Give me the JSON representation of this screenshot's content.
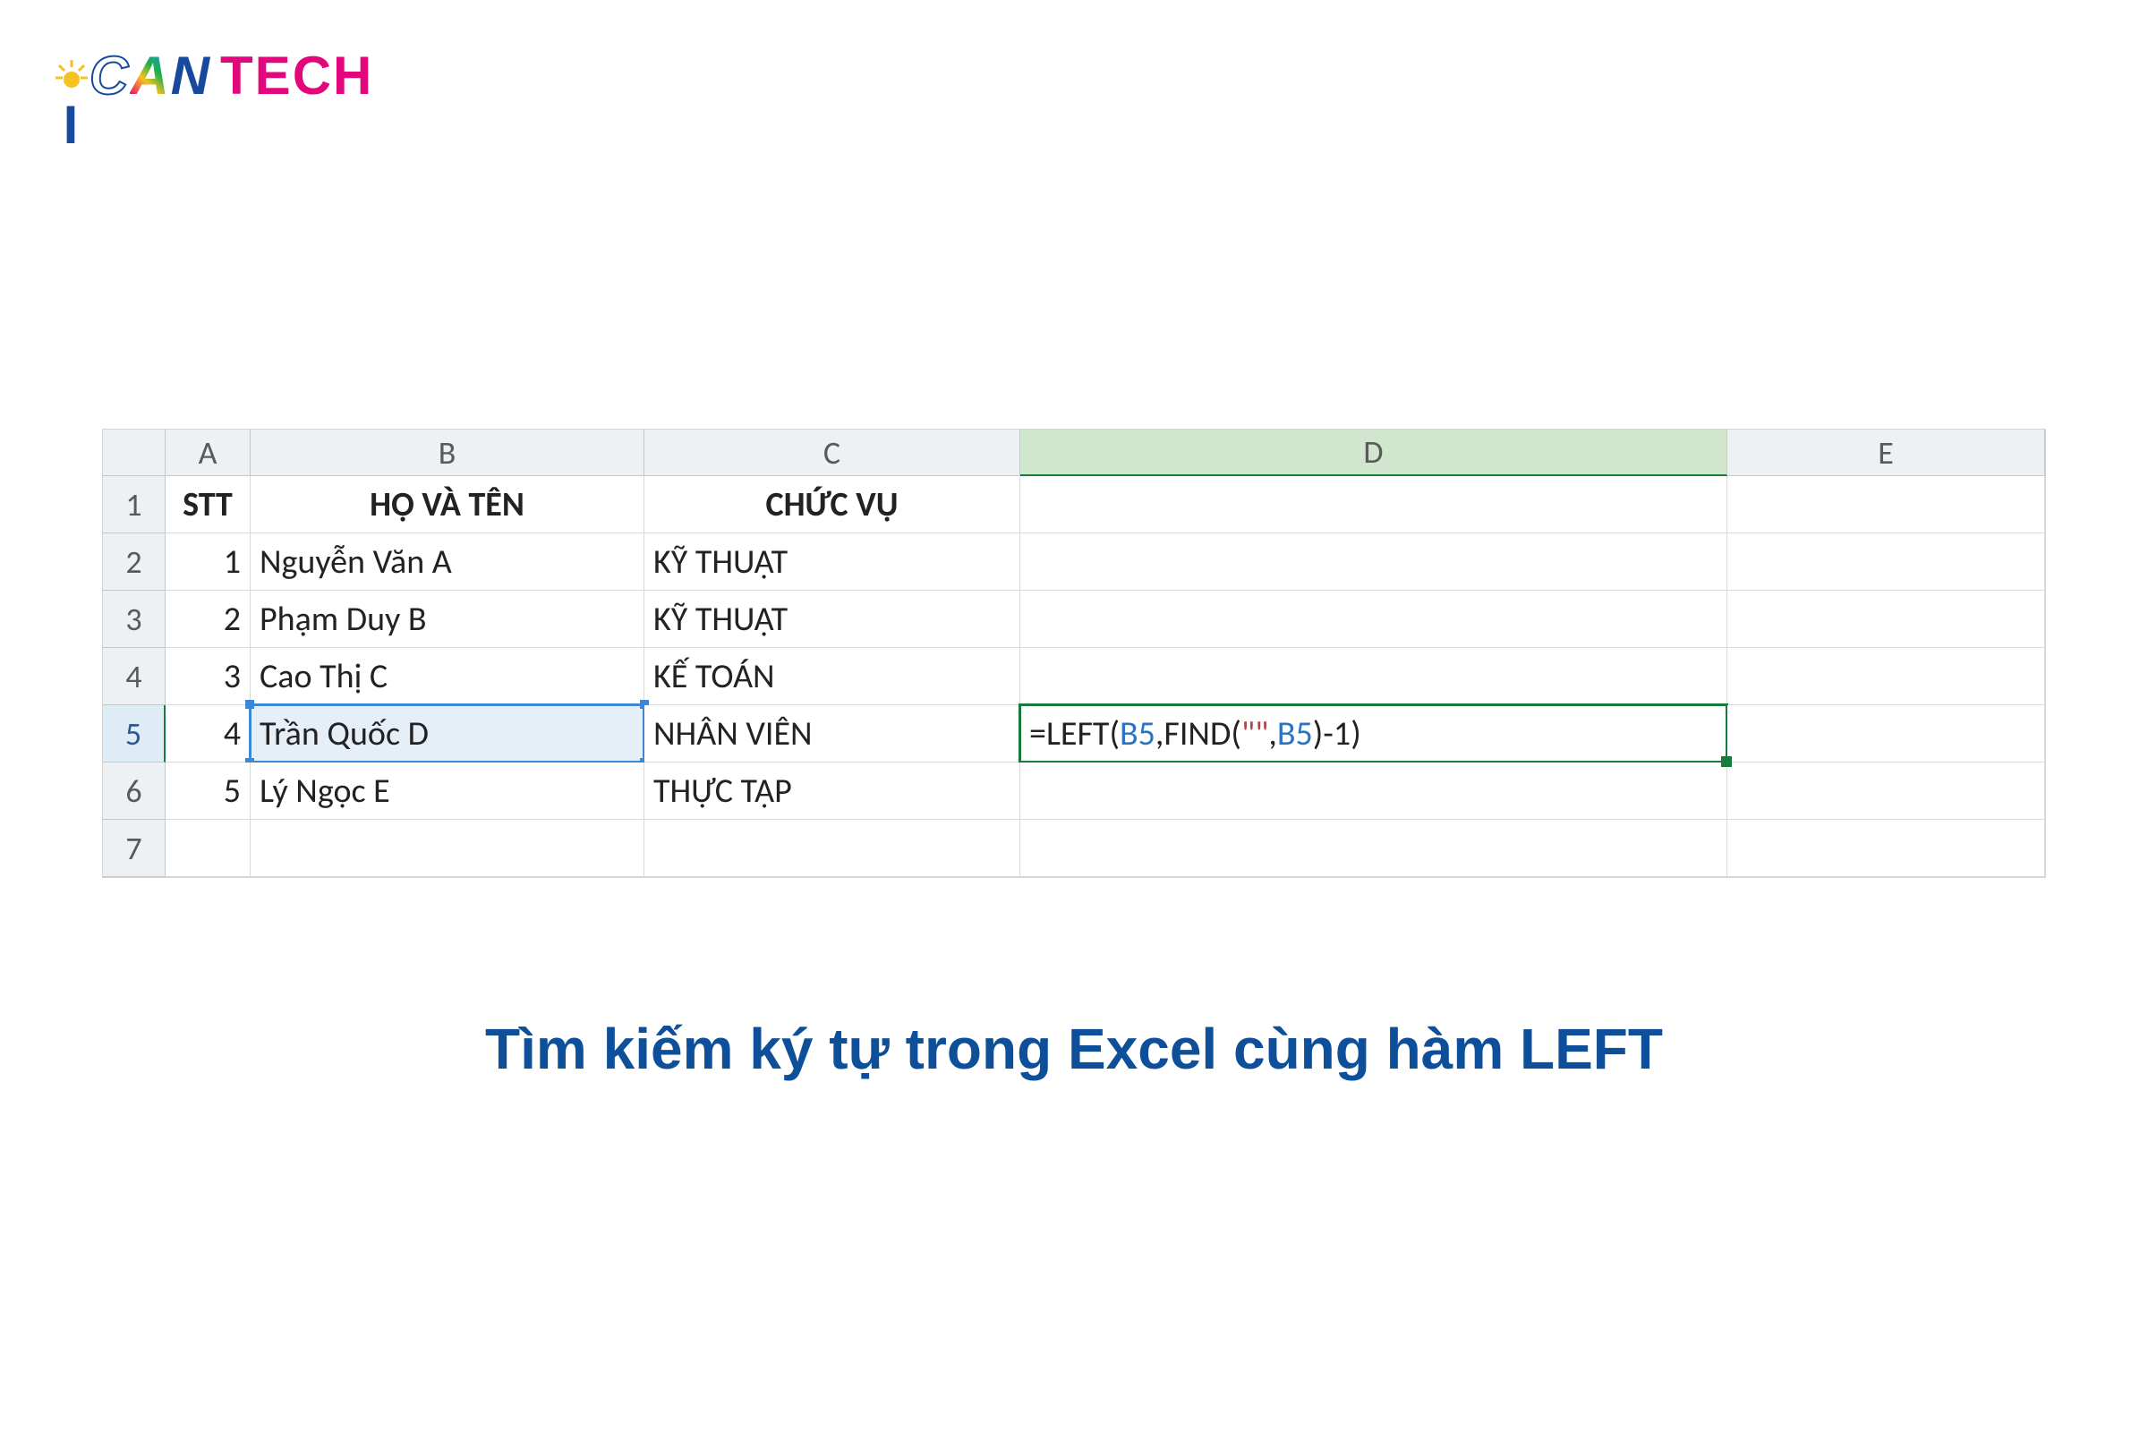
{
  "logo": {
    "part1": "C",
    "part2": "A",
    "part3": "N",
    "part4": "TECH"
  },
  "columns": [
    "A",
    "B",
    "C",
    "D",
    "E"
  ],
  "rows": [
    "1",
    "2",
    "3",
    "4",
    "5",
    "6",
    "7"
  ],
  "headers": {
    "a": "STT",
    "b": "HỌ VÀ TÊN",
    "c": "CHỨC VỤ"
  },
  "data": [
    {
      "stt": "1",
      "name": "Nguyễn Văn A",
      "role": "KỸ THUẬT"
    },
    {
      "stt": "2",
      "name": "Phạm Duy B",
      "role": "KỸ THUẬT"
    },
    {
      "stt": "3",
      "name": "Cao Thị C",
      "role": "KẾ TOÁN"
    },
    {
      "stt": "4",
      "name": "Trần Quốc D",
      "role": "NHÂN VIÊN"
    },
    {
      "stt": "5",
      "name": "Lý Ngọc E",
      "role": "THỰC TẬP"
    }
  ],
  "formula": {
    "eq": "=",
    "fn1": "LEFT(",
    "ref1": "B5",
    "sep1": ",",
    "fn2": "FIND(",
    "str": "\"\"",
    "sep2": ",",
    "ref2": "B5",
    "close1": ")",
    "num": "-1",
    "close2": ")"
  },
  "caption": "Tìm kiếm ký tự trong Excel cùng hàm LEFT"
}
